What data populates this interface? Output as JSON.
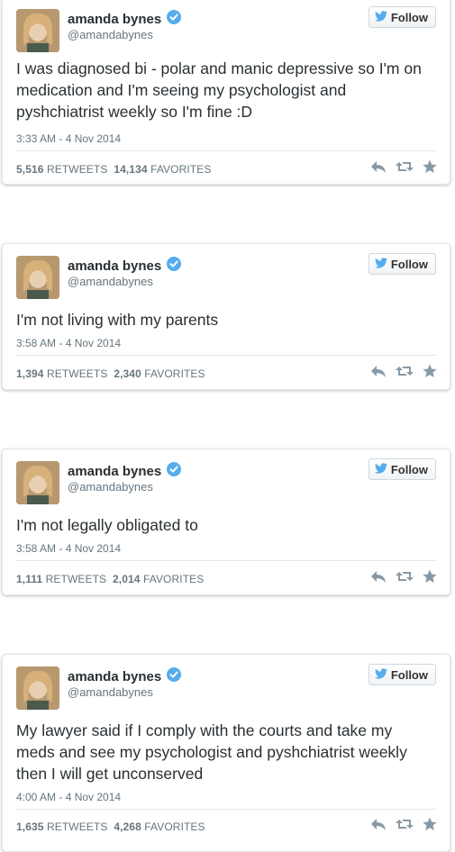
{
  "user": {
    "name": "amanda bynes",
    "handle": "@amandabynes",
    "follow_label": "Follow",
    "verified_color": "#55acee",
    "brand_color": "#55acee"
  },
  "tweets": [
    {
      "lines": [
        "I was diagnosed bi - polar and manic depressive so I'm on",
        "medication and I'm seeing my psychologist and",
        "pyshchiatrist weekly so I'm fine :D"
      ],
      "time": "3:33 AM - 4 Nov 2014",
      "retweets": "5,516",
      "favorites": "14,134"
    },
    {
      "lines": [
        "I'm not living with my parents"
      ],
      "time": "3:58 AM - 4 Nov 2014",
      "retweets": "1,394",
      "favorites": "2,340"
    },
    {
      "lines": [
        "I'm not legally obligated to"
      ],
      "time": "3:58 AM - 4 Nov 2014",
      "retweets": "1,111",
      "favorites": "2,014"
    },
    {
      "lines": [
        "My lawyer said if I comply with the courts and take my",
        "meds and see my psychologist and pyshchiatrist weekly",
        "then I will get unconserved"
      ],
      "time": "4:00 AM - 4 Nov 2014",
      "retweets": "1,635",
      "favorites": "4,268"
    }
  ],
  "labels": {
    "retweets": "RETWEETS",
    "favorites": "FAVORITES"
  },
  "icons": [
    "verified-badge-icon",
    "twitter-bird-icon",
    "reply-icon",
    "retweet-icon",
    "favorite-star-icon"
  ]
}
